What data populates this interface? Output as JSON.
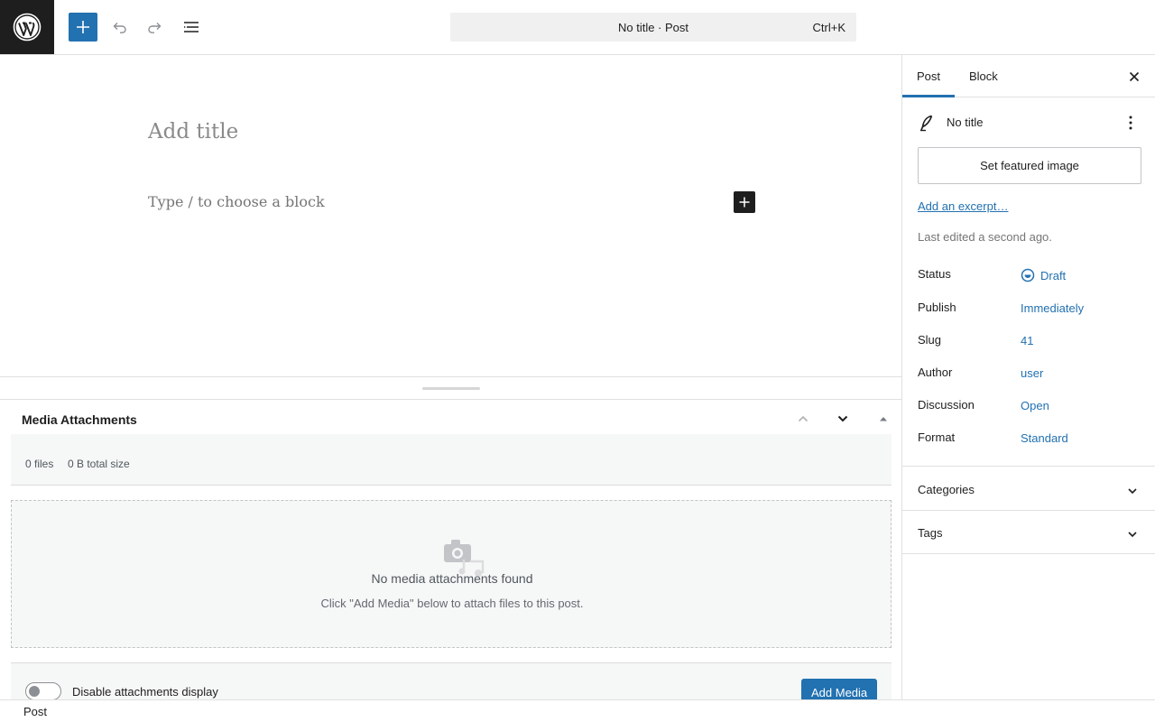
{
  "topbar": {
    "logo_icon": "wordpress-logo",
    "command_bar_text": "No title · Post",
    "command_shortcut": "Ctrl+K",
    "accent_color": "#2271b1"
  },
  "editor": {
    "title_placeholder": "Add title",
    "block_placeholder": "Type / to choose a block"
  },
  "metabox": {
    "title": "Media Attachments",
    "files_count": "0 files",
    "total_size": "0 B total size",
    "empty_title": "No media attachments found",
    "empty_subtitle": "Click \"Add Media\" below to attach files to this post.",
    "toggle_label": "Disable attachments display",
    "add_media_label": "Add Media"
  },
  "sidebar": {
    "tabs": [
      "Post",
      "Block"
    ],
    "active_tab": "Post",
    "post_title": "No title",
    "featured_image_label": "Set featured image",
    "excerpt_link": "Add an excerpt…",
    "last_edited": "Last edited a second ago.",
    "meta": [
      {
        "label": "Status",
        "value": "Draft"
      },
      {
        "label": "Publish",
        "value": "Immediately"
      },
      {
        "label": "Slug",
        "value": "41"
      },
      {
        "label": "Author",
        "value": "user"
      },
      {
        "label": "Discussion",
        "value": "Open"
      },
      {
        "label": "Format",
        "value": "Standard"
      }
    ],
    "panels": [
      "Categories",
      "Tags"
    ]
  },
  "footer": {
    "breadcrumb": "Post"
  }
}
